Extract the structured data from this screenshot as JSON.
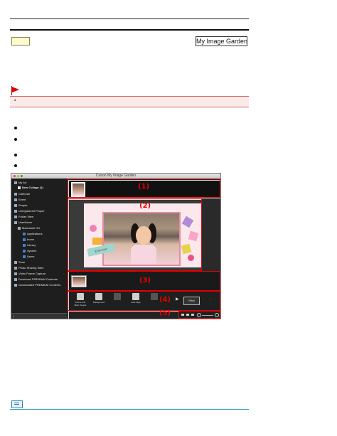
{
  "header": {
    "brand": "My Image Garden"
  },
  "app": {
    "window_title": "Canon My Image Garden",
    "sidebar": {
      "items": [
        {
          "label": "My Art",
          "level": 0
        },
        {
          "label": "New Collage (1)",
          "level": 1,
          "selected": true
        },
        {
          "label": "Calendar",
          "level": 0
        },
        {
          "label": "Event",
          "level": 0
        },
        {
          "label": "People",
          "level": 0
        },
        {
          "label": "Unregistered People",
          "level": 0
        },
        {
          "label": "Folder View",
          "level": 0
        },
        {
          "label": "UserName",
          "level": 0
        },
        {
          "label": "Macintosh HD",
          "level": 1
        },
        {
          "label": "Applications",
          "level": 2
        },
        {
          "label": "home",
          "level": 2
        },
        {
          "label": "Library",
          "level": 2
        },
        {
          "label": "System",
          "level": 2
        },
        {
          "label": "Users",
          "level": 2
        },
        {
          "label": "Scan",
          "level": 0
        },
        {
          "label": "Photo Sharing Sites",
          "level": 0
        },
        {
          "label": "Video Frame Capture",
          "level": 0
        },
        {
          "label": "Download PREMIUM Contents",
          "level": 0
        },
        {
          "label": "Downloaded PREMIUM Contents",
          "level": 0
        }
      ]
    },
    "canvas": {
      "enter_text": "Enter text"
    },
    "toolbar": {
      "buttons": [
        {
          "label": "Frame and Main People",
          "enabled": true
        },
        {
          "label": "Background",
          "enabled": true
        },
        {
          "label": "Layout",
          "enabled": false
        },
        {
          "label": "Add Page",
          "enabled": true
        },
        {
          "label": "",
          "enabled": false
        }
      ],
      "print_label": "Print"
    },
    "callouts": [
      "(1)",
      "(2)",
      "(3)",
      "(4)",
      "(5)"
    ]
  },
  "colors": {
    "accent_red": "#e60000",
    "notice_bg": "#fbeaea",
    "note_line": "#2c9db2"
  }
}
